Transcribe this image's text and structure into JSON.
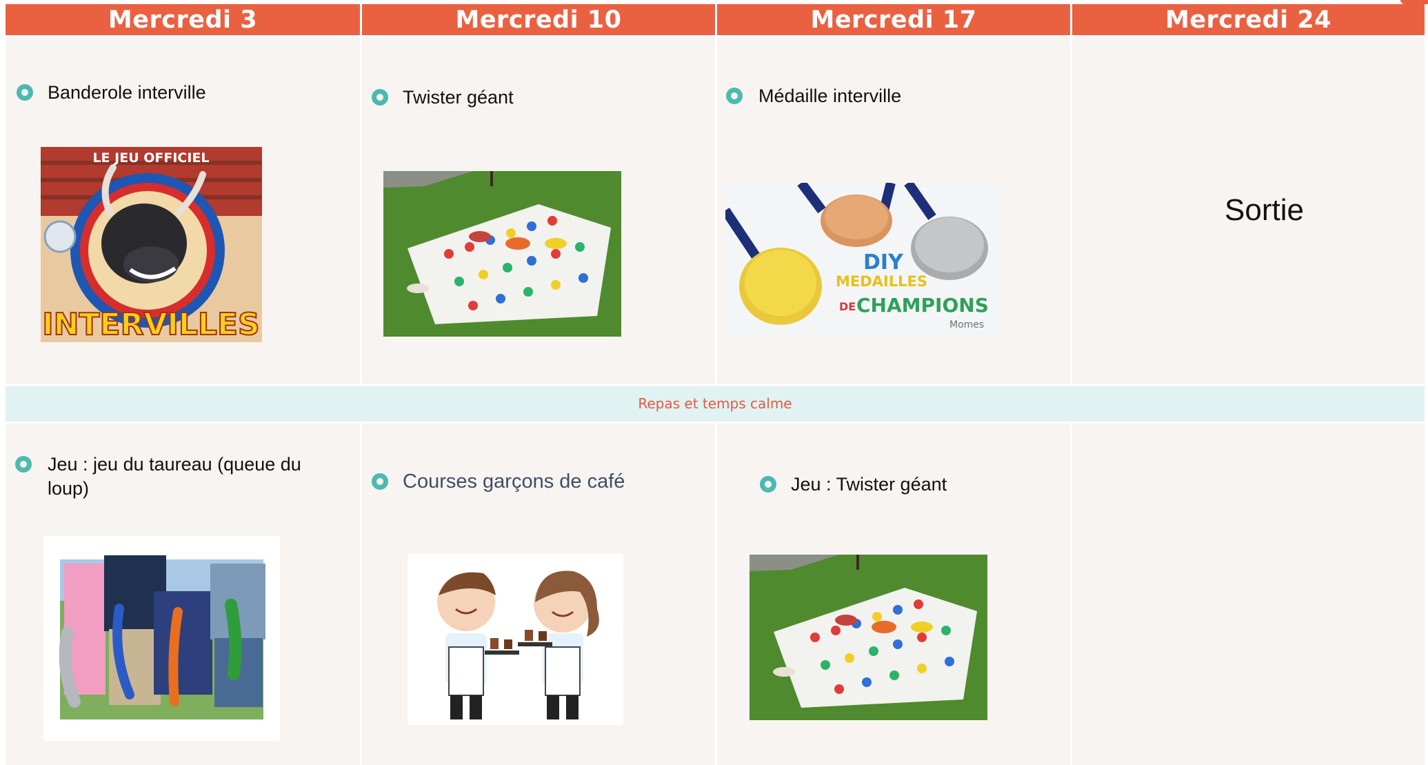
{
  "headers": [
    "Mercredi 3",
    "Mercredi 10",
    "Mercredi 17",
    "Mercredi 24"
  ],
  "morning": [
    {
      "label": "Banderole interville"
    },
    {
      "label": "Twister géant"
    },
    {
      "label": "Médaille interville"
    },
    {
      "label": "Sortie"
    }
  ],
  "break_label": "Repas et temps calme",
  "afternoon": [
    {
      "label": "Jeu :  jeu du taureau (queue du loup)"
    },
    {
      "label": "Courses garçons de café"
    },
    {
      "label": "Jeu : Twister géant"
    }
  ],
  "image_text": {
    "intervilles_top": "LE JEU OFFICIEL",
    "intervilles_title": "INTERVILLES",
    "medal_line1": "DIY",
    "medal_line2": "MEDAILLES",
    "medal_line3a": "DE",
    "medal_line3b": "CHAMPIONS",
    "medal_brand": "Momes"
  },
  "colors": {
    "header": "#ea6142",
    "band": "#e1f2f2",
    "band_text": "#e05a44",
    "bullet": "#4bbab0",
    "cell": "#f7f4f1"
  }
}
